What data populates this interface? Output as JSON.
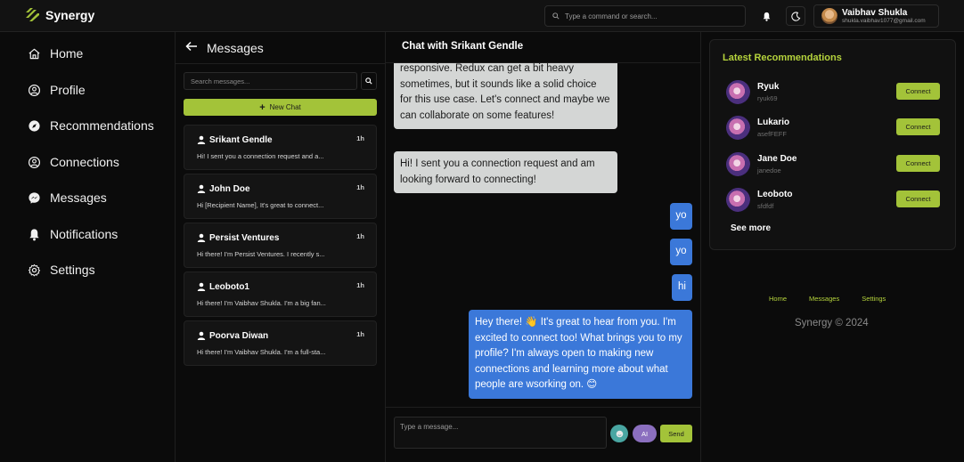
{
  "brand": {
    "name": "Synergy",
    "accent": "#a3c339"
  },
  "topbar": {
    "command_placeholder": "Type a command or search...",
    "user": {
      "name": "Vaibhav Shukla",
      "email": "shukla.vaibhav1077@gmail.com"
    }
  },
  "nav": {
    "items": [
      {
        "label": "Home",
        "icon": "home-icon"
      },
      {
        "label": "Profile",
        "icon": "user-circle-icon"
      },
      {
        "label": "Recommendations",
        "icon": "compass-icon"
      },
      {
        "label": "Connections",
        "icon": "user-circle-icon"
      },
      {
        "label": "Messages",
        "icon": "messenger-icon"
      },
      {
        "label": "Notifications",
        "icon": "bell-icon"
      },
      {
        "label": "Settings",
        "icon": "gear-icon"
      }
    ]
  },
  "messages": {
    "title": "Messages",
    "search_placeholder": "Search messages...",
    "new_chat": "New Chat",
    "conversations": [
      {
        "name": "Srikant Gendle",
        "time": "1h",
        "preview": "Hi! I sent you a connection request and a..."
      },
      {
        "name": "John Doe",
        "time": "1h",
        "preview": "Hi [Recipient Name], It's great to connect..."
      },
      {
        "name": "Persist Ventures",
        "time": "1h",
        "preview": "Hi there! I'm Persist Ventures. I recently s..."
      },
      {
        "name": "Leoboto1",
        "time": "1h",
        "preview": "Hi there! I'm Vaibhav Shukla. I'm a big fan..."
      },
      {
        "name": "Poorva Diwan",
        "time": "1h",
        "preview": "Hi there! I'm Vaibhav Shukla. I'm a full-sta..."
      }
    ]
  },
  "chat": {
    "title": "Chat with Srikant Gendle",
    "messages": [
      {
        "from": "them",
        "text": "responsive. Redux can get a bit heavy sometimes, but it sounds like a solid choice for this use case. Let's connect and maybe we can collaborate on some features!"
      },
      {
        "from": "them",
        "text": "Hi! I sent you a connection request and am looking forward to connecting!"
      },
      {
        "from": "me",
        "text": "yo"
      },
      {
        "from": "me",
        "text": "yo"
      },
      {
        "from": "me",
        "text": "hi"
      },
      {
        "from": "me",
        "text": "Hey there! 👋 It's great to hear from you. I'm excited to connect too! What brings you to my profile? I'm always open to making new connections and learning more about what people are wsorking on. 😊"
      }
    ],
    "input_placeholder": "Type a message...",
    "ai_label": "AI",
    "send_label": "Send"
  },
  "recommendations": {
    "title": "Latest Recommendations",
    "items": [
      {
        "name": "Ryuk",
        "handle": "ryuk69",
        "action": "Connect"
      },
      {
        "name": "Lukario",
        "handle": "asefFEFF",
        "action": "Connect"
      },
      {
        "name": "Jane Doe",
        "handle": "janedoe",
        "action": "Connect"
      },
      {
        "name": "Leoboto",
        "handle": "sfdfdf",
        "action": "Connect"
      }
    ],
    "see_more": "See more"
  },
  "footer": {
    "links": [
      "Home",
      "Messages",
      "Settings"
    ],
    "copyright": "Synergy © 2024"
  }
}
